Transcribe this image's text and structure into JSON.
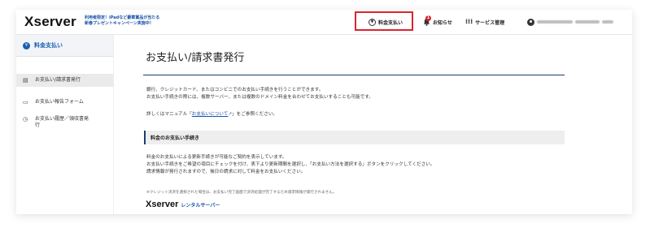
{
  "header": {
    "logo": "Xserver",
    "promo_line1": "利用者限定！iPadなど豪華賞品が当たる",
    "promo_line2": "新春プレゼントキャンペーン実施中！",
    "nav": {
      "payment": "料金支払い",
      "news": "お知らせ",
      "service": "サービス管理",
      "news_badge": "1"
    }
  },
  "sidebar": {
    "heading": "料金支払い",
    "items": [
      {
        "label": "お支払い/請求書発行"
      },
      {
        "label": "お支払い報告フォーム"
      },
      {
        "label": "お支払い履歴／領収書発行"
      }
    ]
  },
  "main": {
    "title": "お支払い/請求書発行",
    "intro_line1": "銀行、クレジットカード、またはコンビニでのお支払い手続きを行うことができます。",
    "intro_line2": "お支払い手続きの際には、複数サーバー、または複数のドメイン料金を合わせてお支払いすることも可能です。",
    "manual_prefix": "詳しくはマニュアル「",
    "manual_link": "お支払いについて",
    "manual_suffix": "」をご参照ください。",
    "section_title": "料金のお支払い手続き",
    "body_line1": "料金のお支払いによる更新手続きが可能なご契約を表示しています。",
    "body_line2": "お支払い手続きをご希望の項目にチェックを付け、表下より更新期間を選択し、「お支払い方法を選択する」ボタンをクリックしてください。",
    "body_line3": "請求情報が発行されますので、後日の請求に対して料金をお支払いください。",
    "note": "※クレジット決済を選択された場合は、お支払い完了画面で決済処理が完了するため請求情報が発行されません。",
    "footer_logo": "Xserver",
    "footer_sub": "レンタルサーバー"
  },
  "colors": {
    "accent": "#1a5fb4",
    "highlight_border": "#d8262e",
    "title_rule": "#1a3e6e"
  }
}
